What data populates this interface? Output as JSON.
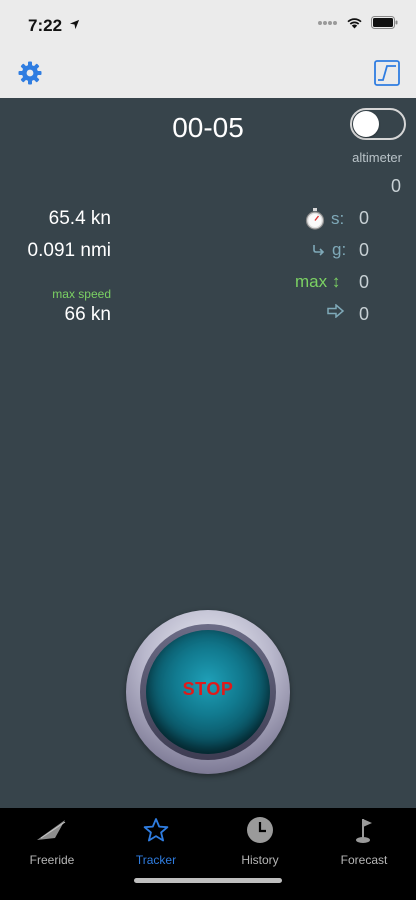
{
  "status": {
    "time": "7:22"
  },
  "nav": {
    "settings_icon": "gear-icon",
    "chart_icon": "chart-icon",
    "accent": "#2f7de1"
  },
  "tracker": {
    "timer": "00-05",
    "altimeter_label": "altimeter",
    "altimeter_value": "0",
    "speed": "65.4 kn",
    "distance": "0.091 nmi",
    "max_speed_label": "max speed",
    "max_speed_value": "66 kn",
    "stats": [
      {
        "label": "s:",
        "value": "0",
        "icon": "stopwatch-icon"
      },
      {
        "label": "g:",
        "value": "0",
        "icon": "glide-arrow-icon"
      },
      {
        "label": "max ↕",
        "value": "0"
      },
      {
        "label": "",
        "value": "0",
        "icon": "right-arrow-icon"
      }
    ],
    "stop_label": "STOP"
  },
  "tabs": [
    {
      "label": "Freeride",
      "icon": "hang-glider-icon"
    },
    {
      "label": "Tracker",
      "icon": "star-icon",
      "active": true
    },
    {
      "label": "History",
      "icon": "clock-icon"
    },
    {
      "label": "Forecast",
      "icon": "flag-icon"
    }
  ]
}
